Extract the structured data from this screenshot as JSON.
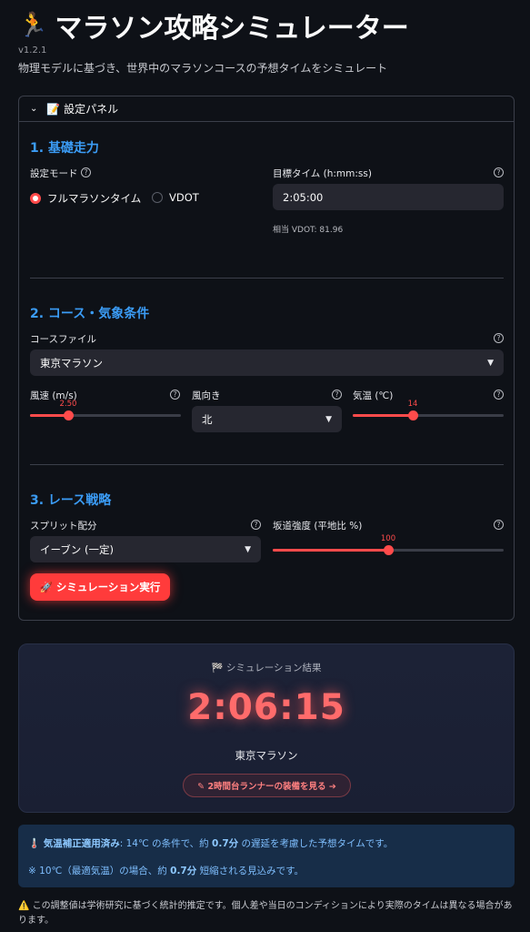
{
  "header": {
    "title": "マラソン攻略シミュレーター",
    "version": "v1.2.1",
    "subtitle": "物理モデルに基づき、世界中のマラソンコースの予想タイムをシミュレート"
  },
  "panel": {
    "title": "📝 設定パネル",
    "section1": {
      "heading": "1. 基礎走力",
      "mode_label": "設定モード",
      "mode_options": [
        "フルマラソンタイム",
        "VDOT"
      ],
      "mode_selected": "フルマラソンタイム",
      "target_label": "目標タイム (h:mm:ss)",
      "target_value": "2:05:00",
      "vdot_hint": "相当 VDOT: 81.96"
    },
    "section2": {
      "heading": "2. コース・気象条件",
      "course_label": "コースファイル",
      "course_value": "東京マラソン",
      "wind_label": "風速 (m/s)",
      "wind_value": "2.50",
      "wind_fraction": 0.25,
      "dir_label": "風向き",
      "dir_value": "北",
      "temp_label": "気温 (℃)",
      "temp_value": "14",
      "temp_fraction": 0.4
    },
    "section3": {
      "heading": "3. レース戦略",
      "split_label": "スプリット配分",
      "split_value": "イーブン (一定)",
      "hill_label": "坂道強度 (平地比 %)",
      "hill_value": "100",
      "hill_fraction": 0.5,
      "run_button": "🚀 シミュレーション実行"
    }
  },
  "result": {
    "label": "🏁 シミュレーション結果",
    "time": "2:06:15",
    "course": "東京マラソン",
    "gear_button": "✎ 2時間台ランナーの装備を見る ➔"
  },
  "info": {
    "line1_strong": "🌡️ 気温補正適用済み",
    "line1_text": ": 14℃ の条件で、約 ",
    "line1_value": "0.7分",
    "line1_tail": " の遅延を考慮した予想タイムです。",
    "line2_text": "※ 10℃（最適気温）の場合、約 ",
    "line2_value": "0.7分",
    "line2_tail": " 短縮される見込みです。"
  },
  "note": "⚠️ この調整値は学術研究に基づく統計的推定です。個人差や当日のコンディションにより実際のタイムは異なる場合があります。",
  "colors": {
    "accent": "#ff4b4b",
    "heading": "#3b9cf6",
    "background": "#0e1117",
    "info_bg": "#172d48"
  }
}
